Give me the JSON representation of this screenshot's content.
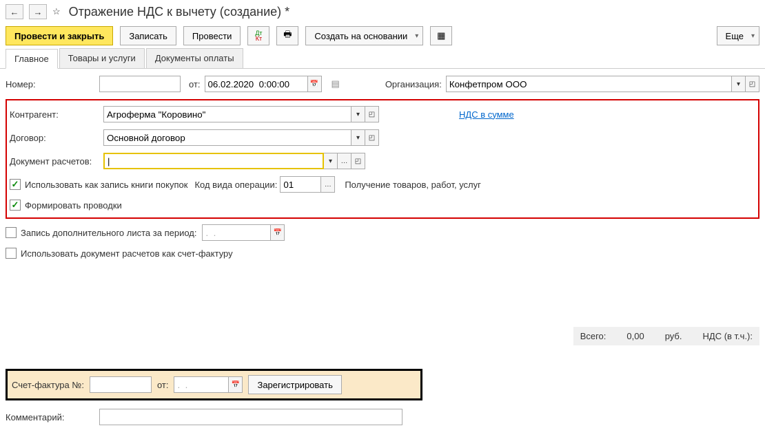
{
  "header": {
    "title": "Отражение НДС к вычету (создание) *"
  },
  "toolbar": {
    "post_close": "Провести и закрыть",
    "write": "Записать",
    "post": "Провести",
    "create_based": "Создать на основании",
    "more": "Еще"
  },
  "tabs": {
    "main": "Главное",
    "goods": "Товары и услуги",
    "pay_docs": "Документы оплаты"
  },
  "fields": {
    "number_lbl": "Номер:",
    "from_lbl": "от:",
    "date_val": "06.02.2020  0:00:00",
    "org_lbl": "Организация:",
    "org_val": "Конфетпром ООО",
    "counterparty_lbl": "Контрагент:",
    "counterparty_val": "Агроферма \"Коровино\"",
    "vat_link": "НДС в сумме",
    "contract_lbl": "Договор:",
    "contract_val": "Основной договор",
    "doc_lbl": "Документ расчетов:",
    "chk_book": "Использовать как запись книги покупок",
    "op_code_lbl": "Код вида операции:",
    "op_code_val": "01",
    "op_desc": "Получение товаров, работ, услуг",
    "chk_entries": "Формировать проводки",
    "chk_addl": "Запись дополнительного листа за период:",
    "addl_date": ".  .",
    "chk_use_doc": "Использовать документ расчетов как счет-фактуру",
    "invoice_lbl": "Счет-фактура №:",
    "invoice_from": "от:",
    "invoice_date": ".  .",
    "register_btn": "Зарегистрировать",
    "comment_lbl": "Комментарий:",
    "total_lbl": "Всего:",
    "total_val": "0,00",
    "total_cur": "руб.",
    "vat_lbl": "НДС (в т.ч.):"
  }
}
